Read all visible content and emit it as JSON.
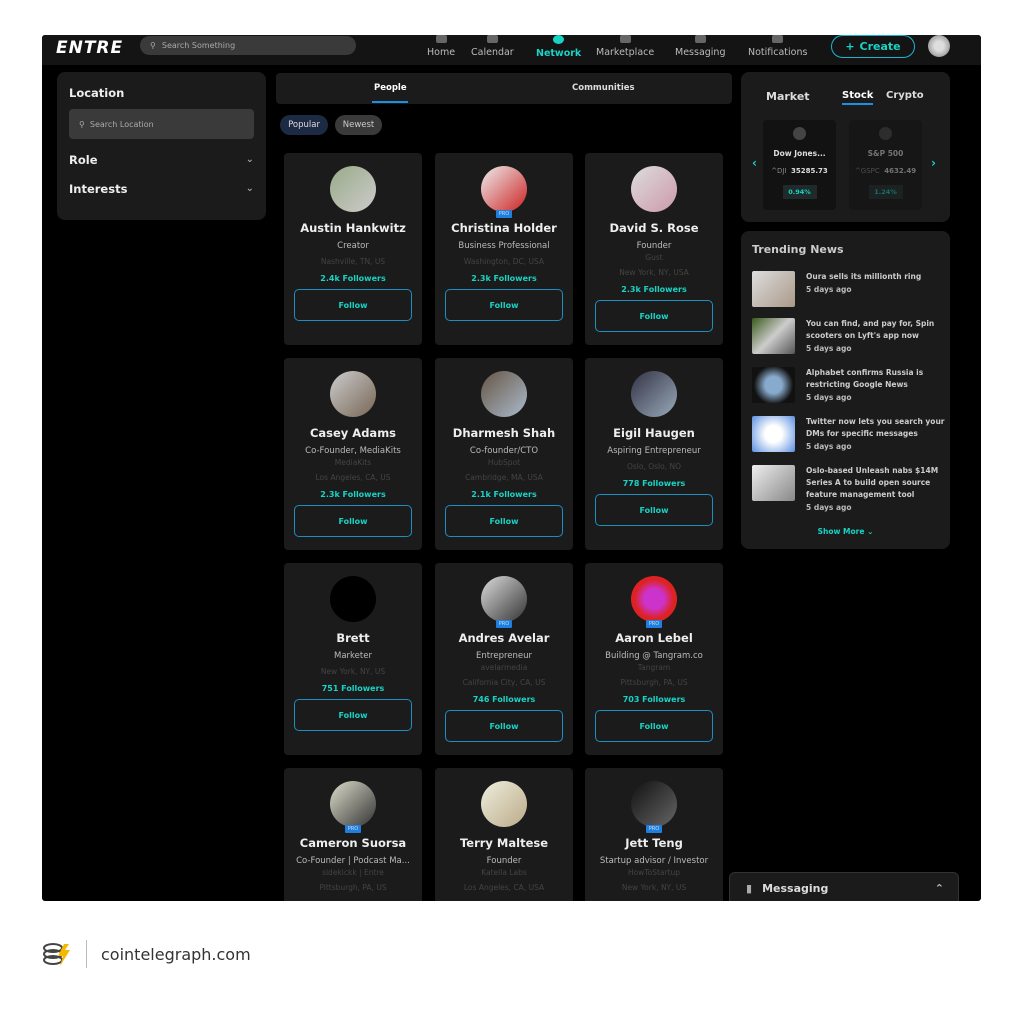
{
  "header": {
    "logo": "ENTRE",
    "search_placeholder": "Search Something",
    "nav": [
      {
        "label": "Home",
        "active": false
      },
      {
        "label": "Calendar",
        "active": false
      },
      {
        "label": "Network",
        "active": true
      },
      {
        "label": "Marketplace",
        "active": false
      },
      {
        "label": "Messaging",
        "active": false
      },
      {
        "label": "Notifications",
        "active": false
      }
    ],
    "create_label": "Create"
  },
  "filters": {
    "location_title": "Location",
    "location_placeholder": "Search Location",
    "role_label": "Role",
    "interests_label": "Interests"
  },
  "tabs": {
    "people": "People",
    "communities": "Communities"
  },
  "sort": {
    "popular": "Popular",
    "newest": "Newest"
  },
  "people": [
    {
      "name": "Austin Hankwitz",
      "role": "Creator",
      "company": "",
      "location": "Nashville, TN, US",
      "followers": "2.4k Followers",
      "pro": false,
      "follow": "Follow"
    },
    {
      "name": "Christina Holder",
      "role": "Business Professional",
      "company": "",
      "location": "Washington, DC, USA",
      "followers": "2.3k Followers",
      "pro": true,
      "follow": "Follow"
    },
    {
      "name": "David S. Rose",
      "role": "Founder",
      "company": "Gust",
      "location": "New York, NY, USA",
      "followers": "2.3k Followers",
      "pro": false,
      "follow": "Follow"
    },
    {
      "name": "Casey Adams",
      "role": "Co-Founder, MediaKits",
      "company": "MediaKits",
      "location": "Los Angeles, CA, US",
      "followers": "2.3k Followers",
      "pro": false,
      "follow": "Follow"
    },
    {
      "name": "Dharmesh Shah",
      "role": "Co-founder/CTO",
      "company": "HubSpot",
      "location": "Cambridge, MA, USA",
      "followers": "2.1k Followers",
      "pro": false,
      "follow": "Follow"
    },
    {
      "name": "Eigil Haugen",
      "role": "Aspiring Entrepreneur",
      "company": "",
      "location": "Oslo, Oslo, NO",
      "followers": "778 Followers",
      "pro": false,
      "follow": "Follow"
    },
    {
      "name": "Brett",
      "role": "Marketer",
      "company": "",
      "location": "New York, NY, US",
      "followers": "751 Followers",
      "pro": false,
      "follow": "Follow"
    },
    {
      "name": "Andres Avelar",
      "role": "Entrepreneur",
      "company": "avelarmedia",
      "location": "California City, CA, US",
      "followers": "746 Followers",
      "pro": true,
      "follow": "Follow"
    },
    {
      "name": "Aaron Lebel",
      "role": "Building @ Tangram.co",
      "company": "Tangram",
      "location": "Pittsburgh, PA, US",
      "followers": "703 Followers",
      "pro": true,
      "follow": "Follow"
    },
    {
      "name": "Cameron Suorsa",
      "role": "Co-Founder | Podcast Ma...",
      "company": "sidekickk | Entre",
      "location": "Pittsburgh, PA, US",
      "followers": "",
      "pro": true,
      "follow": ""
    },
    {
      "name": "Terry Maltese",
      "role": "Founder",
      "company": "Katella Labs",
      "location": "Los Angeles, CA, USA",
      "followers": "",
      "pro": false,
      "follow": ""
    },
    {
      "name": "Jett Teng",
      "role": "Startup advisor / Investor",
      "company": "HowToStartup",
      "location": "New York, NY, US",
      "followers": "",
      "pro": true,
      "follow": ""
    }
  ],
  "market": {
    "title": "Market",
    "tabs": [
      "Stock",
      "Crypto"
    ],
    "active_tab": "Stock",
    "items": [
      {
        "name": "Dow Jones...",
        "ticker": "^DJI",
        "price": "35285.73",
        "change": "0.94%"
      },
      {
        "name": "S&P 500",
        "ticker": "^GSPC",
        "price": "4632.49",
        "change": "1.24%"
      }
    ]
  },
  "news": {
    "title": "Trending News",
    "items": [
      {
        "title": "Oura sells its millionth ring",
        "time": "5 days ago"
      },
      {
        "title": "You can find, and pay for, Spin scooters on Lyft's app now",
        "time": "5 days ago"
      },
      {
        "title": "Alphabet confirms Russia is restricting Google News",
        "time": "5 days ago"
      },
      {
        "title": "Twitter now lets you search your DMs for specific messages",
        "time": "5 days ago"
      },
      {
        "title": "Oslo-based Unleash nabs $14M Series A to build open source feature management tool",
        "time": "5 days ago"
      }
    ],
    "show_more": "Show More"
  },
  "messaging": {
    "label": "Messaging"
  },
  "footer": {
    "site": "cointelegraph.com"
  },
  "colors": {
    "accent": "#19d3c5",
    "blue": "#1a90e0",
    "panel": "#1b1b1b"
  }
}
